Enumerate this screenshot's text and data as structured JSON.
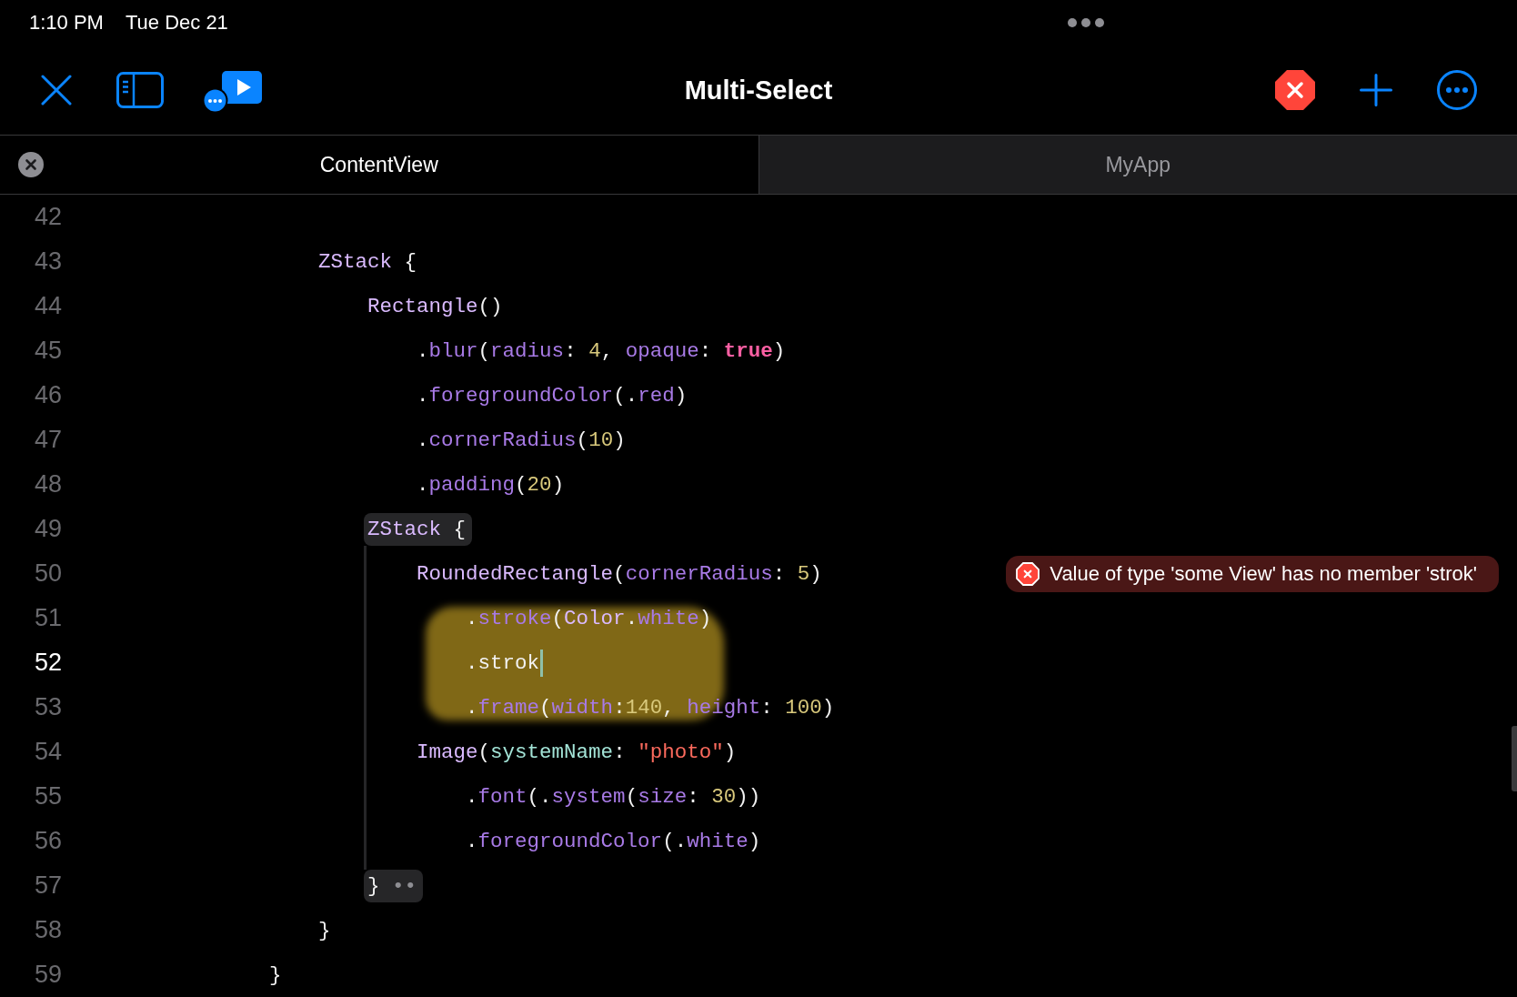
{
  "status_bar": {
    "time": "1:10 PM",
    "date": "Tue Dec 21"
  },
  "toolbar": {
    "title": "Multi-Select"
  },
  "tabs": [
    {
      "label": "ContentView",
      "selected": true
    },
    {
      "label": "MyApp",
      "selected": false
    }
  ],
  "editor": {
    "lines": [
      {
        "number": "42",
        "highlighted": false,
        "current": false,
        "marked": false
      },
      {
        "number": "43",
        "tokens": [
          {
            "text": "                ZStack",
            "kind": "type"
          },
          {
            "text": " {",
            "kind": "plain"
          }
        ],
        "highlighted": false,
        "current": false,
        "marked": false
      },
      {
        "number": "44",
        "tokens": [
          {
            "text": "                    Rectangle",
            "kind": "type"
          },
          {
            "text": "()",
            "kind": "plain"
          }
        ],
        "highlighted": false,
        "current": false,
        "marked": false
      },
      {
        "number": "45",
        "tokens": [
          {
            "text": "                        .",
            "kind": "plain"
          },
          {
            "text": "blur",
            "kind": "member"
          },
          {
            "text": "(",
            "kind": "plain"
          },
          {
            "text": "radius",
            "kind": "member"
          },
          {
            "text": ": ",
            "kind": "plain"
          },
          {
            "text": "4",
            "kind": "number"
          },
          {
            "text": ", ",
            "kind": "plain"
          },
          {
            "text": "opaque",
            "kind": "member"
          },
          {
            "text": ": ",
            "kind": "plain"
          },
          {
            "text": "true",
            "kind": "keyword"
          },
          {
            "text": ")",
            "kind": "plain"
          }
        ],
        "highlighted": false,
        "current": false,
        "marked": false
      },
      {
        "number": "46",
        "tokens": [
          {
            "text": "                        .",
            "kind": "plain"
          },
          {
            "text": "foregroundColor",
            "kind": "member"
          },
          {
            "text": "(.",
            "kind": "plain"
          },
          {
            "text": "red",
            "kind": "member"
          },
          {
            "text": ")",
            "kind": "plain"
          }
        ],
        "highlighted": false,
        "current": false,
        "marked": false
      },
      {
        "number": "47",
        "tokens": [
          {
            "text": "                        .",
            "kind": "plain"
          },
          {
            "text": "cornerRadius",
            "kind": "member"
          },
          {
            "text": "(",
            "kind": "plain"
          },
          {
            "text": "10",
            "kind": "number"
          },
          {
            "text": ")",
            "kind": "plain"
          }
        ],
        "highlighted": false,
        "current": false,
        "marked": false
      },
      {
        "number": "48",
        "tokens": [
          {
            "text": "                        .",
            "kind": "plain"
          },
          {
            "text": "padding",
            "kind": "member"
          },
          {
            "text": "(",
            "kind": "plain"
          },
          {
            "text": "20",
            "kind": "number"
          },
          {
            "text": ")",
            "kind": "plain"
          }
        ],
        "highlighted": false,
        "current": false,
        "marked": false
      },
      {
        "number": "49",
        "tokens": [
          {
            "text": "                    ZStack",
            "kind": "type"
          },
          {
            "text": " {",
            "kind": "plain"
          }
        ],
        "highlighted": true,
        "current": false,
        "marked": false
      },
      {
        "number": "50",
        "tokens": [
          {
            "text": "                        RoundedRectangle",
            "kind": "type"
          },
          {
            "text": "(",
            "kind": "plain"
          },
          {
            "text": "cornerRadius",
            "kind": "member"
          },
          {
            "text": ": ",
            "kind": "plain"
          },
          {
            "text": "5",
            "kind": "number"
          },
          {
            "text": ")",
            "kind": "plain"
          }
        ],
        "highlighted": false,
        "current": false,
        "marked": false,
        "error": {
          "message": "Value of type 'some View' has no member 'strok'"
        }
      },
      {
        "number": "51",
        "tokens": [
          {
            "text": "                            .",
            "kind": "plain"
          },
          {
            "text": "stroke",
            "kind": "member"
          },
          {
            "text": "(",
            "kind": "plain"
          },
          {
            "text": "Color",
            "kind": "type"
          },
          {
            "text": ".",
            "kind": "plain"
          },
          {
            "text": "white",
            "kind": "member"
          },
          {
            "text": ")",
            "kind": "plain"
          }
        ],
        "highlighted": false,
        "current": false,
        "marked": true
      },
      {
        "number": "52",
        "tokens": [
          {
            "text": "                            .strok",
            "kind": "plain"
          }
        ],
        "highlighted": false,
        "current": true,
        "marked": true
      },
      {
        "number": "53",
        "tokens": [
          {
            "text": "                            .",
            "kind": "plain"
          },
          {
            "text": "frame",
            "kind": "member"
          },
          {
            "text": "(",
            "kind": "plain"
          },
          {
            "text": "width",
            "kind": "member"
          },
          {
            "text": ":",
            "kind": "plain"
          },
          {
            "text": "140",
            "kind": "number"
          },
          {
            "text": ", ",
            "kind": "plain"
          },
          {
            "text": "height",
            "kind": "member"
          },
          {
            "text": ": ",
            "kind": "plain"
          },
          {
            "text": "100",
            "kind": "number"
          },
          {
            "text": ")",
            "kind": "plain"
          }
        ],
        "highlighted": false,
        "current": false,
        "marked": true
      },
      {
        "number": "54",
        "tokens": [
          {
            "text": "                        Image",
            "kind": "type"
          },
          {
            "text": "(",
            "kind": "plain"
          },
          {
            "text": "systemName",
            "kind": "label"
          },
          {
            "text": ": ",
            "kind": "plain"
          },
          {
            "text": "\"photo\"",
            "kind": "string"
          },
          {
            "text": ")",
            "kind": "plain"
          }
        ],
        "highlighted": false,
        "current": false,
        "marked": false
      },
      {
        "number": "55",
        "tokens": [
          {
            "text": "                            .",
            "kind": "plain"
          },
          {
            "text": "font",
            "kind": "member"
          },
          {
            "text": "(.",
            "kind": "plain"
          },
          {
            "text": "system",
            "kind": "member"
          },
          {
            "text": "(",
            "kind": "plain"
          },
          {
            "text": "size",
            "kind": "member"
          },
          {
            "text": ": ",
            "kind": "plain"
          },
          {
            "text": "30",
            "kind": "number"
          },
          {
            "text": "))",
            "kind": "plain"
          }
        ],
        "highlighted": false,
        "current": false,
        "marked": false
      },
      {
        "number": "56",
        "tokens": [
          {
            "text": "                            .",
            "kind": "plain"
          },
          {
            "text": "foregroundColor",
            "kind": "member"
          },
          {
            "text": "(.",
            "kind": "plain"
          },
          {
            "text": "white",
            "kind": "member"
          },
          {
            "text": ")",
            "kind": "plain"
          }
        ],
        "highlighted": false,
        "current": false,
        "marked": false
      },
      {
        "number": "57",
        "tokens": [
          {
            "text": "                    }",
            "kind": "plain"
          },
          {
            "text": " ••",
            "kind": "fold"
          }
        ],
        "highlighted": true,
        "current": false,
        "marked": false
      },
      {
        "number": "58",
        "tokens": [
          {
            "text": "                }",
            "kind": "plain"
          }
        ],
        "highlighted": false,
        "current": false,
        "marked": false
      },
      {
        "number": "59",
        "tokens": [
          {
            "text": "            }",
            "kind": "plain"
          }
        ],
        "highlighted": false,
        "current": false,
        "marked": false
      }
    ]
  }
}
